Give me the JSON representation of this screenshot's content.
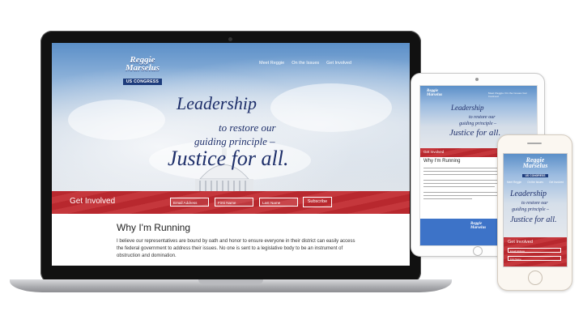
{
  "brand": {
    "name_first": "Reggie",
    "name_last": "Marselus",
    "badge": "US CONGRESS"
  },
  "laptop": {
    "nav": [
      "Meet Reggie",
      "On the Issues",
      "Get Involved"
    ],
    "tagline": {
      "line1": "Leadership",
      "line2": "to restore our",
      "line3": "guiding principle –",
      "line4": "Justice for all."
    },
    "signup": {
      "title": "Get Involved",
      "email_placeholder": "Email Address",
      "first_placeholder": "First Name",
      "last_placeholder": "Last Name",
      "button": "Subscribe"
    },
    "why": {
      "heading": "Why I'm Running",
      "paragraph": "I believe our representatives are bound by oath and honor to ensure everyone in their district can easily access the federal government to address their issues. No one is sent to a legislative body to be an instrument of obstruction and domination."
    }
  },
  "tablet": {
    "nav": "Meet Reggie  On the Issues  Get Involved",
    "tagline": {
      "line1": "Leadership",
      "line2": "to restore our",
      "line3": "guiding principle –",
      "line4": "Justice for all."
    },
    "signup_title": "Get Involved",
    "why_heading": "Why I'm Running"
  },
  "phone": {
    "nav": [
      "Meet Reggie",
      "On the Issues",
      "Get Involved"
    ],
    "tagline": {
      "line1": "Leadership",
      "line2": "to restore our",
      "line3": "guiding principle –",
      "line4": "Justice for all."
    },
    "signup_title": "Get Involved",
    "email_placeholder": "Email Address",
    "first_placeholder": "First Name"
  },
  "colors": {
    "navy": "#1e2f6a",
    "flag_red": "#b8282e",
    "sky_blue": "#5b8fc8",
    "footer_blue": "#3d73c8"
  }
}
